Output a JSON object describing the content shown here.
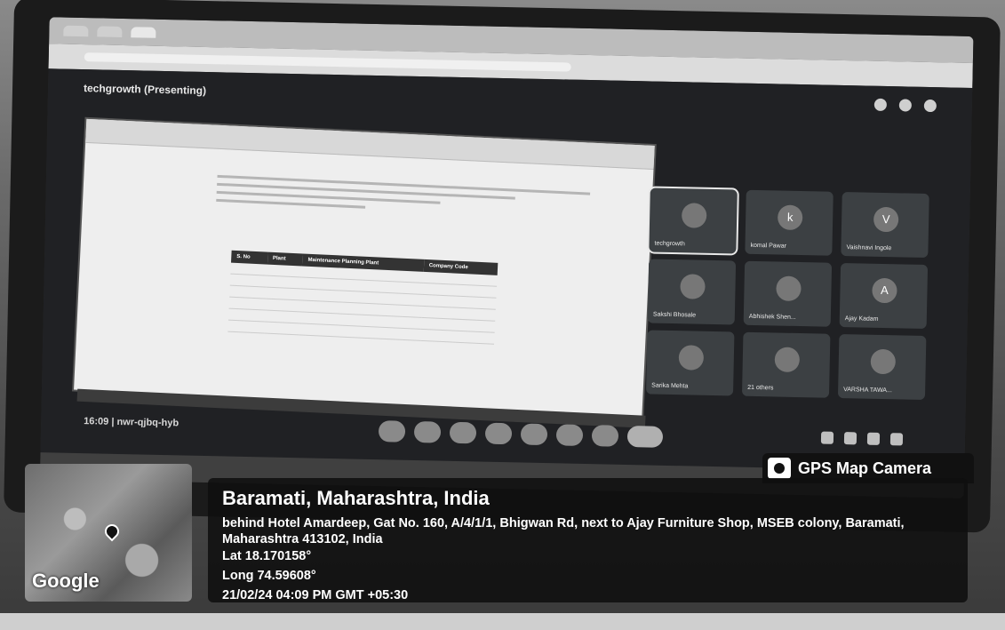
{
  "meet": {
    "presenter": "techgrowth (Presenting)",
    "meeting_code": "16:09  |  nwr-qjbq-hyb",
    "tiles": [
      {
        "initial": "",
        "name": "techgrowth"
      },
      {
        "initial": "k",
        "name": "komal Pawar"
      },
      {
        "initial": "V",
        "name": "Vaishnavi Ingole"
      },
      {
        "initial": "",
        "name": "Sakshi Bhosale"
      },
      {
        "initial": "",
        "name": "Abhishek Shen..."
      },
      {
        "initial": "A",
        "name": "Ajay Kadam"
      },
      {
        "initial": "",
        "name": "Sarika Mehta"
      },
      {
        "initial": "",
        "name": "21 others"
      },
      {
        "initial": "",
        "name": "VARSHA TAWA..."
      }
    ]
  },
  "shared_doc": {
    "table_headers": [
      "S. No",
      "Plant",
      "Maintenance Planning Plant",
      "Company Code"
    ]
  },
  "gps": {
    "badge": "GPS Map Camera",
    "map_brand": "Google",
    "title": "Baramati, Maharashtra, India",
    "address": "behind Hotel Amardeep, Gat No. 160, A/4/1/1, Bhigwan Rd, next to Ajay Furniture Shop, MSEB colony, Baramati, Maharashtra 413102, India",
    "lat": "Lat 18.170158°",
    "long": "Long 74.59608°",
    "datetime": "21/02/24 04:09 PM GMT +05:30"
  }
}
